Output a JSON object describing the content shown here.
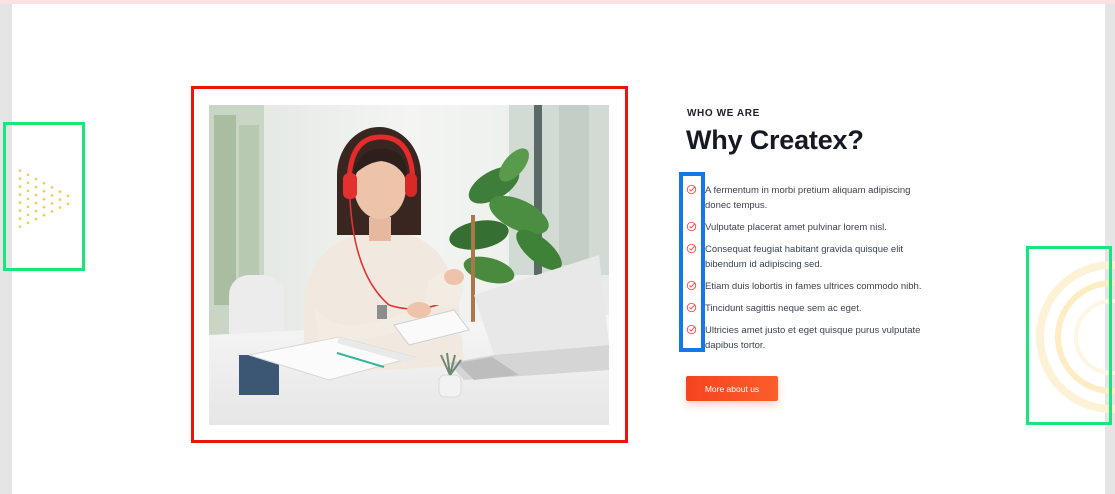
{
  "section": {
    "kicker": "WHO WE ARE",
    "title": "Why Createx?",
    "features": [
      "A fermentum in morbi pretium aliquam adipiscing donec tempus.",
      "Vulputate placerat amet pulvinar lorem nisl.",
      "Consequat feugiat habitant gravida quisque elit bibendum id adipiscing sed.",
      "Etiam duis lobortis in fames ultrices commodo nibh.",
      "Tincidunt sagittis neque sem ac eget.",
      "Ultricies amet justo et eget quisque purus vulputate dapibus tortor."
    ],
    "cta_label": "More about us",
    "feature_icon": "check-circle-icon"
  },
  "image": {
    "subject": "woman-with-headphones-at-laptop-photo"
  },
  "colors": {
    "accent": "#f5441f",
    "heading": "#161824",
    "body_text": "#3c4250",
    "check": "#ff4c4c",
    "dots": "#f7c845",
    "circle_deco": "#fdecc4",
    "annotation_red": "#ee1212",
    "annotation_green": "#17e67a",
    "annotation_blue": "#1479e6",
    "top_strip": "#fbe1df"
  }
}
